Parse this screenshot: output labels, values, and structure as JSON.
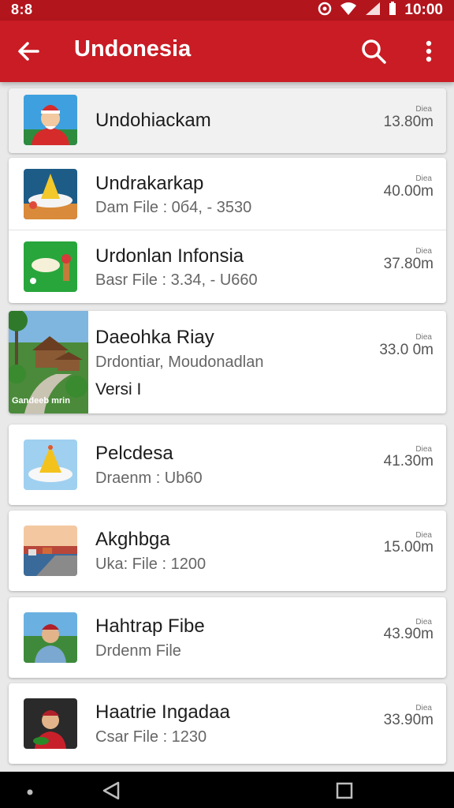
{
  "status_bar": {
    "left_text": "8:8",
    "time": "10:00"
  },
  "app_bar": {
    "title": "Undonesia"
  },
  "items": [
    {
      "title": "Undohiackam",
      "label": "Diea",
      "value": "13.80m"
    },
    {
      "title": "Undrakarkap",
      "subtitle": "Dam File : 0б4, - 3530",
      "label": "Diea",
      "value": "40.00m"
    },
    {
      "title": "Urdonlan Infonsia",
      "subtitle": "Basr File : 3.34, - U660",
      "label": "Diea",
      "value": "37.80m"
    },
    {
      "title": "Daeohka Riay",
      "subtitle": "Drdontiar, Moudonadlan",
      "extra": "Versi I",
      "image_caption": "Gandeeb mrin",
      "label": "Diea",
      "value": "33.0 0m"
    },
    {
      "title": "Pelcdesa",
      "subtitle": "Draenm : Ub60",
      "label": "Diea",
      "value": "41.30m"
    },
    {
      "title": "Akghbga",
      "subtitle": "Uka: File : 1200",
      "label": "Diea",
      "value": "15.00m"
    },
    {
      "title": "Hahtrap Fibe",
      "subtitle": "Drdenm File",
      "label": "Diea",
      "value": "43.90m"
    },
    {
      "title": "Haatrie Ingadaa",
      "subtitle": "Csar File : 1230",
      "label": "Diea",
      "value": "33.90m"
    }
  ],
  "colors": {
    "app_bar": "#c91c24",
    "status_bar": "#b3151d",
    "background": "#e9e9e9"
  }
}
